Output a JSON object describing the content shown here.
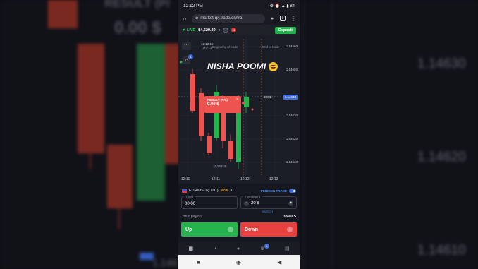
{
  "background": {
    "title": "RESULT (P/",
    "value": "0.00 $",
    "prices": [
      "1.14630",
      "1.14620",
      "1.14610",
      "1.146"
    ],
    "candles": [
      {
        "dir": "down",
        "color": "#8e2f24"
      },
      {
        "dir": "down",
        "color": "#8e2f24"
      },
      {
        "dir": "up",
        "color": "#1f6f3a"
      },
      {
        "dir": "down",
        "color": "#8e2f24"
      },
      {
        "dir": "down",
        "color": "#8e2f24"
      }
    ]
  },
  "status_bar": {
    "time": "12:12 PM",
    "icons": "⚙ ⏰ ▲ ▮ 84"
  },
  "browser": {
    "url": "market-qx.trade/en/tra",
    "tab_count": "9"
  },
  "account": {
    "mode": "LIVE",
    "balance": "$4,629.39",
    "notifications": "10",
    "deposit_label": "Deposit"
  },
  "chart": {
    "overlay_text": "NISHA POOMI",
    "start_label": "12:12:16",
    "start_sub": "UTC+4",
    "trade_label": "Beginning of trade",
    "end_label": "End of trade",
    "y_labels": [
      "1.14660",
      "1.14650",
      "1.14640",
      "1.14630",
      "1.14620",
      "1.14610"
    ],
    "x_labels": [
      "12:10",
      "12:11",
      "12:12",
      "12:13"
    ],
    "current_price": "1.14640",
    "countdown": "00:01",
    "low_label": "1.14613",
    "badge": "1",
    "colors": {
      "up": "#26b24d",
      "down": "#ef5350"
    }
  },
  "result_popup": {
    "title": "RESULT (P/L)",
    "value": "0.00 $"
  },
  "panel": {
    "pair": "EUR/USD (OTC)",
    "payout_pct": "92%",
    "pending": "PENDING TRADE",
    "timer_label": "Timer",
    "timer_value": "00:00",
    "investment_label": "Investment",
    "investment_value": "20 $",
    "switch_label": "SWITCH",
    "your_payout_label": "Your payout",
    "your_payout_value": "38.40 $",
    "up_label": "Up",
    "down_label": "Down"
  },
  "bottom_nav": {
    "badge": "4"
  }
}
